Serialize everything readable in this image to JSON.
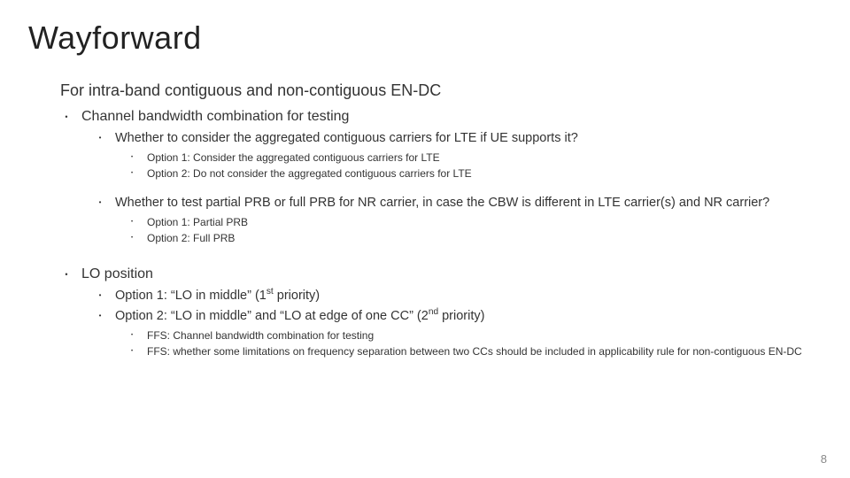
{
  "title": "Wayforward",
  "heading": "For intra-band contiguous and non-contiguous EN-DC",
  "b1": "Channel bandwidth combination for testing",
  "b1a": "Whether to consider the aggregated contiguous carriers for LTE if UE supports it?",
  "b1a1": "Option 1: Consider the aggregated contiguous carriers for LTE",
  "b1a2": "Option 2: Do not consider the aggregated contiguous carriers for LTE",
  "b1b": "Whether to test partial PRB or full PRB for NR carrier, in case the CBW is different in LTE carrier(s) and NR carrier?",
  "b1b1": "Option 1: Partial PRB",
  "b1b2": "Option 2: Full PRB",
  "b2": "LO position",
  "b2a_pre": "Option 1: “LO in middle” (1",
  "b2a_sup": "st",
  "b2a_post": " priority)",
  "b2b_pre": "Option 2: “LO in middle” and “LO at edge of one CC” (2",
  "b2b_sup": "nd",
  "b2b_post": " priority)",
  "b2c1": "FFS: Channel bandwidth combination for testing",
  "b2c2": "FFS: whether some limitations on frequency separation between two CCs should be included in applicability rule for non-contiguous EN-DC",
  "page": "8"
}
